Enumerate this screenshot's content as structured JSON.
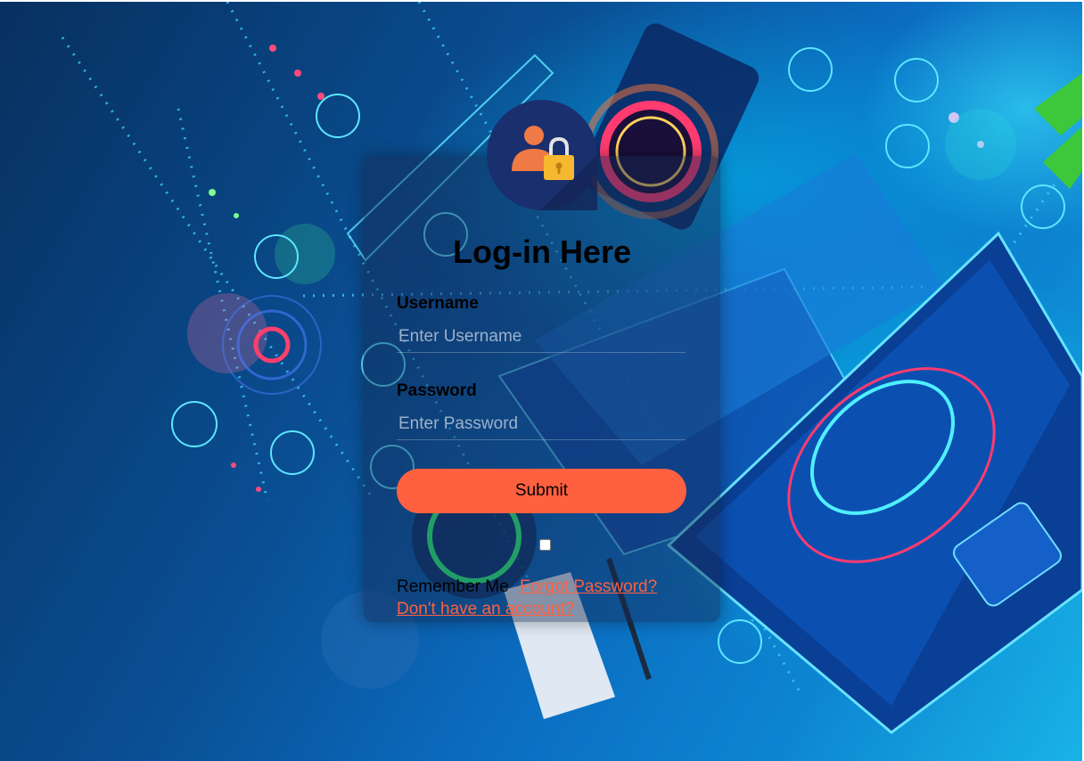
{
  "login": {
    "title": "Log-in Here",
    "username_label": "Username",
    "username_placeholder": "Enter Username",
    "password_label": "Password",
    "password_placeholder": "Enter Password",
    "submit_label": "Submit",
    "remember_label": "Remember Me",
    "remember_checked": false,
    "forgot_link": "Forgot Password?",
    "signup_link": "Don't have an account?"
  },
  "colors": {
    "accent": "#ff6040",
    "avatar_bg": "#1a2f6d",
    "lock": "#f5b82e",
    "person": "#f07a45"
  },
  "icons": {
    "avatar": "user-lock-icon"
  }
}
